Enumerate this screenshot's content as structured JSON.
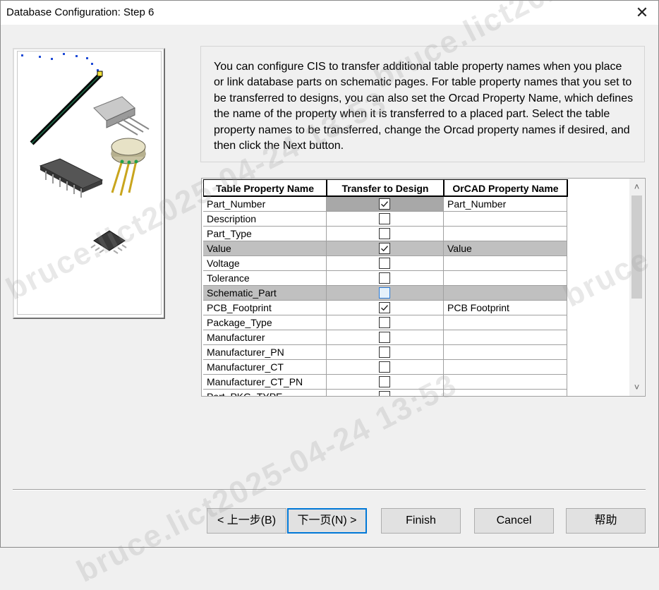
{
  "window": {
    "title": "Database Configuration: Step 6",
    "close_glyph": "✕"
  },
  "description": "You can configure CIS to transfer additional table property names when you place or link database parts on schematic pages. For table property names that you set to be transferred to designs, you can also set the Orcad Property Name, which defines the name of the property when it is transferred to a placed part. Select the table property names to be transferred, change the Orcad property names if desired, and then click the Next button.",
  "table": {
    "headers": [
      "Table Property Name",
      "Transfer to Design",
      "OrCAD Property Name"
    ],
    "rows": [
      {
        "name": "Part_Number",
        "transfer": true,
        "orcad": "Part_Number"
      },
      {
        "name": "Description",
        "transfer": false,
        "orcad": ""
      },
      {
        "name": "Part_Type",
        "transfer": false,
        "orcad": ""
      },
      {
        "name": "Value",
        "transfer": true,
        "orcad": "Value"
      },
      {
        "name": "Voltage",
        "transfer": false,
        "orcad": ""
      },
      {
        "name": "Tolerance",
        "transfer": false,
        "orcad": ""
      },
      {
        "name": "Schematic_Part",
        "transfer": false,
        "orcad": ""
      },
      {
        "name": "PCB_Footprint",
        "transfer": true,
        "orcad": "PCB Footprint"
      },
      {
        "name": "Package_Type",
        "transfer": false,
        "orcad": ""
      },
      {
        "name": "Manufacturer",
        "transfer": false,
        "orcad": ""
      },
      {
        "name": "Manufacturer_PN",
        "transfer": false,
        "orcad": ""
      },
      {
        "name": "Manufacturer_CT",
        "transfer": false,
        "orcad": ""
      },
      {
        "name": "Manufacturer_CT_PN",
        "transfer": false,
        "orcad": ""
      },
      {
        "name": "Part_PKG_TYPE",
        "transfer": false,
        "orcad": ""
      }
    ]
  },
  "buttons": {
    "back": "< 上一步(B)",
    "next": "下一页(N) >",
    "finish": "Finish",
    "cancel": "Cancel",
    "help": "帮助"
  },
  "watermarks": [
    "bruce.lict2025-04-24 13:53",
    "bruce.lict2025-04-24 13:53",
    "bruce.lict2025-04-24 13:53",
    "bruce"
  ],
  "colors": {
    "accent": "#0078d7",
    "selected_row": "#c0c0c0"
  }
}
